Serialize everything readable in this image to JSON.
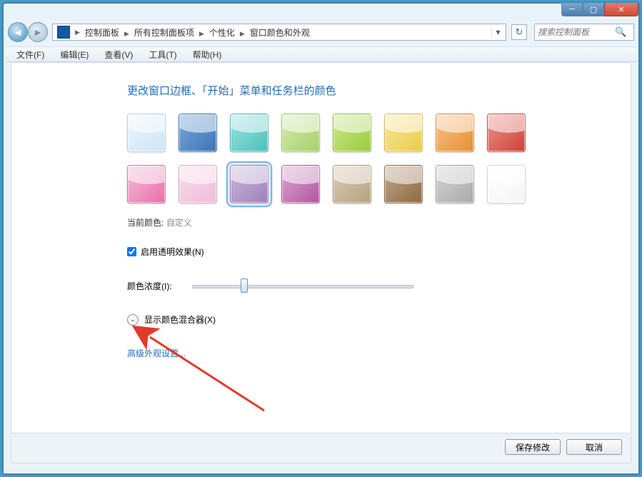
{
  "window": {
    "min_icon": "─",
    "max_icon": "▢",
    "close_icon": "✕"
  },
  "nav": {
    "back": "◄",
    "fwd": "►",
    "refresh": "↻",
    "dropdown": "▾"
  },
  "breadcrumbs": [
    "控制面板",
    "所有控制面板项",
    "个性化",
    "窗口颜色和外观"
  ],
  "search": {
    "placeholder": "搜索控制面板",
    "icon": "🔍"
  },
  "menu": {
    "file": "文件(F)",
    "edit": "编辑(E)",
    "view": "查看(V)",
    "tools": "工具(T)",
    "help": "帮助(H)"
  },
  "heading": "更改窗口边框、「开始」菜单和任务栏的颜色",
  "swatches": [
    {
      "name": "sky",
      "c1": "#eaf4fd",
      "c2": "#cfe6f8"
    },
    {
      "name": "blue",
      "c1": "#7aa9da",
      "c2": "#3e74b6"
    },
    {
      "name": "teal",
      "c1": "#9ee3e0",
      "c2": "#48c1bb"
    },
    {
      "name": "leaf",
      "c1": "#d4ecb0",
      "c2": "#a6d06b"
    },
    {
      "name": "lime",
      "c1": "#cde989",
      "c2": "#9acb3e"
    },
    {
      "name": "sun",
      "c1": "#f7e9a1",
      "c2": "#eacb46"
    },
    {
      "name": "orange",
      "c1": "#f5c58c",
      "c2": "#e88e2f"
    },
    {
      "name": "red",
      "c1": "#ea938c",
      "c2": "#cf4238"
    },
    {
      "name": "pink",
      "c1": "#f6bdd6",
      "c2": "#e870ad"
    },
    {
      "name": "blush",
      "c1": "#f6dcea",
      "c2": "#f1bcda"
    },
    {
      "name": "violet",
      "c1": "#cbb9da",
      "c2": "#9e7fbe"
    },
    {
      "name": "fuchsia",
      "c1": "#d9a8ce",
      "c2": "#b256a0"
    },
    {
      "name": "taupe",
      "c1": "#d8cbb6",
      "c2": "#b6a280"
    },
    {
      "name": "brown",
      "c1": "#bfa78c",
      "c2": "#8d6a42"
    },
    {
      "name": "slate",
      "c1": "#d5d5d5",
      "c2": "#a9a9a9"
    },
    {
      "name": "frost",
      "c1": "#ffffff",
      "c2": "#f4f4f4"
    }
  ],
  "selected_swatch_index": 10,
  "current_color": {
    "label": "当前颜色:",
    "value": "自定义"
  },
  "transparency": {
    "label": "启用透明效果(N)",
    "checked": true
  },
  "intensity": {
    "label": "颜色浓度(I):",
    "value": 22
  },
  "mixer": {
    "label": "显示颜色混合器(X)",
    "chev": "⌄"
  },
  "adv_link": "高级外观设置...",
  "footer": {
    "save": "保存修改",
    "cancel": "取消"
  }
}
